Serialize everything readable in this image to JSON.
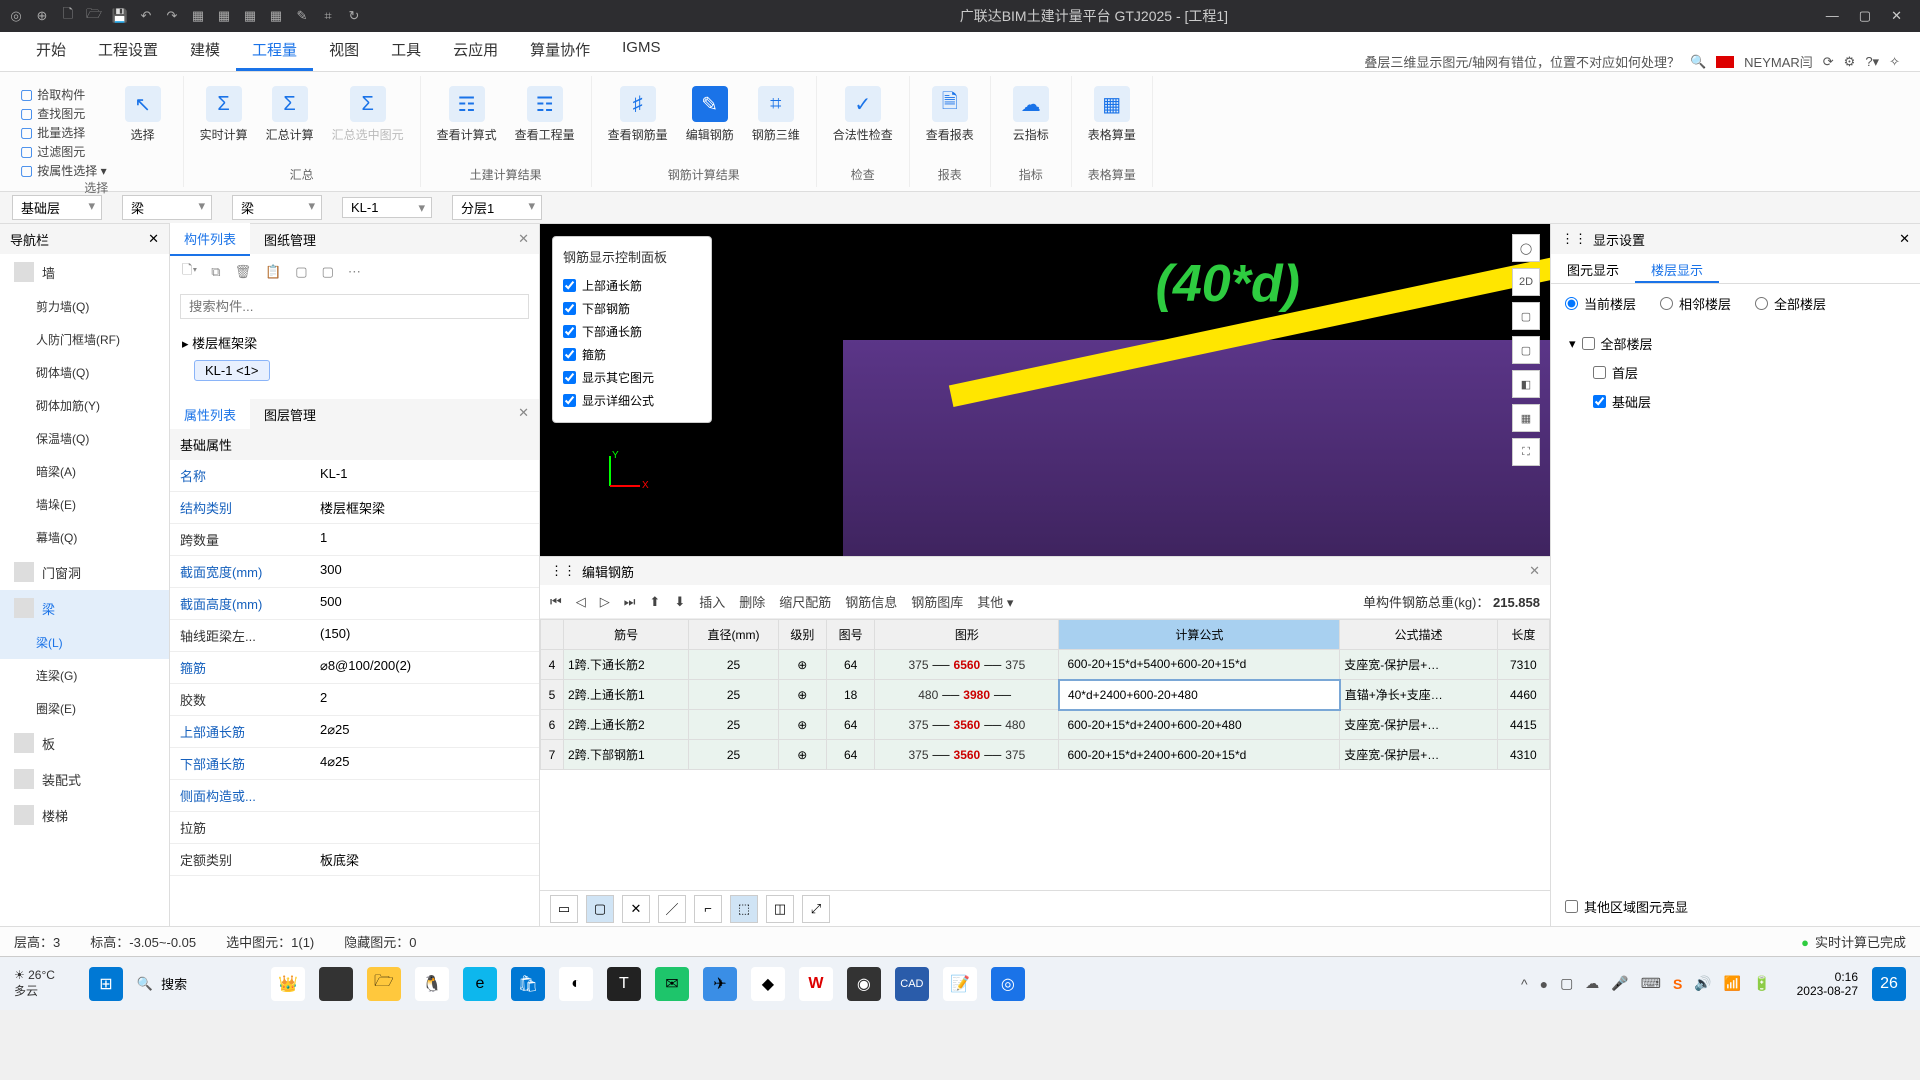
{
  "titlebar": {
    "title": "广联达BIM土建计量平台 GTJ2025 - [工程1]"
  },
  "menu": {
    "tabs": [
      "开始",
      "工程设置",
      "建模",
      "工程量",
      "视图",
      "工具",
      "云应用",
      "算量协作",
      "IGMS"
    ],
    "active": 3,
    "help_q": "叠层三维显示图元/轴网有错位，位置不对应如何处理？",
    "user": "NEYMAR闫"
  },
  "ribbon": {
    "groups": [
      {
        "label": "选择",
        "small": [
          "拾取构件",
          "查找图元",
          "批量选择",
          "过滤图元",
          "按属性选择 ▾"
        ],
        "btns": [
          {
            "icon": "↖",
            "lbl": "选择"
          }
        ]
      },
      {
        "label": "汇总",
        "btns": [
          {
            "icon": "Σ",
            "lbl": "实时计算"
          },
          {
            "icon": "Σ",
            "lbl": "汇总计算"
          },
          {
            "icon": "Σ",
            "lbl": "汇总选中图元",
            "dim": true
          }
        ]
      },
      {
        "label": "土建计算结果",
        "btns": [
          {
            "icon": "☶",
            "lbl": "查看计算式"
          },
          {
            "icon": "☶",
            "lbl": "查看工程量"
          }
        ]
      },
      {
        "label": "钢筋计算结果",
        "btns": [
          {
            "icon": "♯",
            "lbl": "查看钢筋量"
          },
          {
            "icon": "✎",
            "lbl": "编辑钢筋",
            "active": true
          },
          {
            "icon": "⌗",
            "lbl": "钢筋三维"
          }
        ]
      },
      {
        "label": "检查",
        "btns": [
          {
            "icon": "✓",
            "lbl": "合法性检查"
          }
        ]
      },
      {
        "label": "报表",
        "btns": [
          {
            "icon": "🗎",
            "lbl": "查看报表"
          }
        ]
      },
      {
        "label": "指标",
        "btns": [
          {
            "icon": "☁",
            "lbl": "云指标"
          }
        ]
      },
      {
        "label": "表格算量",
        "btns": [
          {
            "icon": "▦",
            "lbl": "表格算量"
          }
        ]
      }
    ]
  },
  "ddbar": [
    "基础层",
    "梁",
    "梁",
    "KL-1",
    "分层1"
  ],
  "leftnav": {
    "title": "导航栏",
    "items": [
      {
        "lbl": "墙",
        "icon": true
      },
      {
        "lbl": "剪力墙(Q)",
        "sub": true
      },
      {
        "lbl": "人防门框墙(RF)",
        "sub": true
      },
      {
        "lbl": "砌体墙(Q)",
        "sub": true
      },
      {
        "lbl": "砌体加筋(Y)",
        "sub": true
      },
      {
        "lbl": "保温墙(Q)",
        "sub": true
      },
      {
        "lbl": "暗梁(A)",
        "sub": true
      },
      {
        "lbl": "墙垛(E)",
        "sub": true
      },
      {
        "lbl": "幕墙(Q)",
        "sub": true
      },
      {
        "lbl": "门窗洞",
        "icon": true
      },
      {
        "lbl": "梁",
        "icon": true,
        "active": true
      },
      {
        "lbl": "梁(L)",
        "sub": true,
        "active": true
      },
      {
        "lbl": "连梁(G)",
        "sub": true
      },
      {
        "lbl": "圈梁(E)",
        "sub": true
      },
      {
        "lbl": "板",
        "icon": true
      },
      {
        "lbl": "装配式",
        "icon": true
      },
      {
        "lbl": "楼梯",
        "icon": true
      }
    ]
  },
  "complist": {
    "tabs": [
      "构件列表",
      "图纸管理"
    ],
    "search_ph": "搜索构件...",
    "tree_parent": "▸ 楼层框架梁",
    "tree_item": "KL-1 <1>"
  },
  "proppanel": {
    "tabs": [
      "属性列表",
      "图层管理"
    ],
    "section": "基础属性",
    "rows": [
      {
        "k": "名称",
        "v": "KL-1"
      },
      {
        "k": "结构类别",
        "v": "楼层框架梁"
      },
      {
        "k": "跨数量",
        "v": "1",
        "plain": true
      },
      {
        "k": "截面宽度(mm)",
        "v": "300"
      },
      {
        "k": "截面高度(mm)",
        "v": "500"
      },
      {
        "k": "轴线距梁左...",
        "v": "(150)",
        "plain": true
      },
      {
        "k": "箍筋",
        "v": "⌀8@100/200(2)"
      },
      {
        "k": "胶数",
        "v": "2",
        "plain": true
      },
      {
        "k": "上部通长筋",
        "v": "2⌀25"
      },
      {
        "k": "下部通长筋",
        "v": "4⌀25"
      },
      {
        "k": "侧面构造或...",
        "v": ""
      },
      {
        "k": "拉筋",
        "v": "",
        "plain": true
      },
      {
        "k": "定额类别",
        "v": "板底梁",
        "plain": true
      }
    ]
  },
  "ctlpanel": {
    "title": "钢筋显示控制面板",
    "items": [
      "上部通长筋",
      "下部钢筋",
      "下部通长筋",
      "箍筋",
      "显示其它图元",
      "显示详细公式"
    ]
  },
  "overlay3d": "(40*d)",
  "rebared": {
    "title": "编辑钢筋",
    "tools": [
      "⏮",
      "◁",
      "▷",
      "⏭",
      "⬆",
      "⬇",
      "插入",
      "删除",
      "缩尺配筋",
      "钢筋信息",
      "钢筋图库",
      "其他 ▾"
    ],
    "weight_label": "单构件钢筋总重(kg)：",
    "weight_val": "215.858",
    "headers": [
      "",
      "筋号",
      "直径(mm)",
      "级别",
      "图号",
      "图形",
      "计算公式",
      "公式描述",
      "长度"
    ],
    "rows": [
      {
        "n": "4",
        "name": "1跨.下通长筋2",
        "dia": "25",
        "lvl": "⊕",
        "pic": "64",
        "e1": "375",
        "seg": "6560",
        "e2": "375",
        "formula": "600-20+15*d+5400+600-20+15*d",
        "desc": "支座宽-保护层+…",
        "len": "7310"
      },
      {
        "n": "5",
        "name": "2跨.上通长筋1",
        "dia": "25",
        "lvl": "⊕",
        "pic": "18",
        "e1": "480",
        "seg": "3980",
        "e2": "",
        "formula": "40*d+2400+600-20+480",
        "desc": "直锚+净长+支座…",
        "len": "4460",
        "editing": true
      },
      {
        "n": "6",
        "name": "2跨.上通长筋2",
        "dia": "25",
        "lvl": "⊕",
        "pic": "64",
        "e1": "375",
        "seg": "3560",
        "e2": "480",
        "formula": "600-20+15*d+2400+600-20+480",
        "desc": "支座宽-保护层+…",
        "len": "4415"
      },
      {
        "n": "7",
        "name": "2跨.下部钢筋1",
        "dia": "25",
        "lvl": "⊕",
        "pic": "64",
        "e1": "375",
        "seg": "3560",
        "e2": "375",
        "formula": "600-20+15*d+2400+600-20+15*d",
        "desc": "支座宽-保护层+…",
        "len": "4310"
      }
    ]
  },
  "rightpanel": {
    "title": "显示设置",
    "tabs": [
      "图元显示",
      "楼层显示"
    ],
    "radios": [
      "当前楼层",
      "相邻楼层",
      "全部楼层"
    ],
    "tree": {
      "root": "全部楼层",
      "children": [
        "首层",
        "基础层"
      ]
    },
    "highlight": "其他区域图元亮显"
  },
  "status": {
    "floor_lbl": "层高：",
    "floor": "3",
    "elev_lbl": "标高：",
    "elev": "-3.05~-0.05",
    "sel_lbl": "选中图元：",
    "sel": "1(1)",
    "hid_lbl": "隐藏图元：",
    "hid": "0",
    "calc": "实时计算已完成"
  },
  "taskbar": {
    "temp": "26°C",
    "cond": "多云",
    "search_ph": "搜索",
    "time": "0:16",
    "date": "2023-08-27",
    "notif": "26"
  }
}
